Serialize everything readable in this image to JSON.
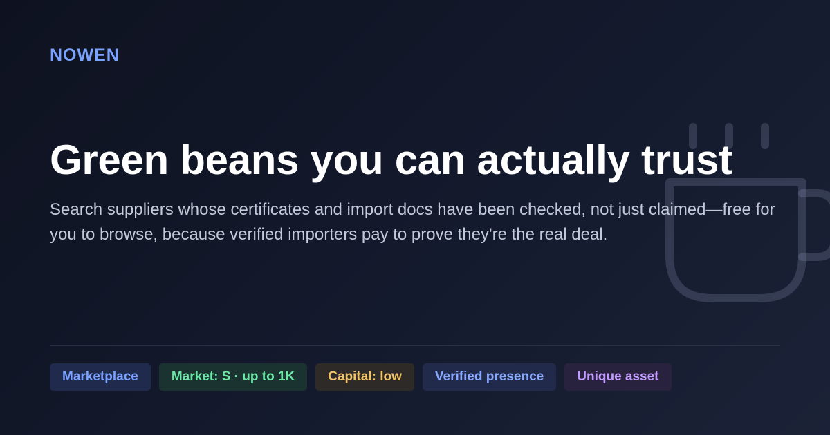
{
  "brand": {
    "name": "NOWEN"
  },
  "hero": {
    "headline": "Green beans you can actually trust",
    "subtext": "Search suppliers whose certificates and import docs have been checked, not just claimed—free for you to browse, because verified importers pay to prove they're the real deal."
  },
  "tags": [
    {
      "label": "Marketplace",
      "color": "#7aa2ff"
    },
    {
      "label": "Market: S · up to 1K",
      "color": "#6ee7a6"
    },
    {
      "label": "Capital: low",
      "color": "#f0c26a"
    },
    {
      "label": "Verified presence",
      "color": "#89a9ff"
    },
    {
      "label": "Unique asset",
      "color": "#c39cff"
    }
  ],
  "decoration": {
    "icon": "coffee-mug-icon",
    "color": "#9aa6c4"
  },
  "colors": {
    "background": "#111627",
    "accent": "#7aa2ff",
    "headline": "#ffffff",
    "body_text": "#c2c9d8"
  }
}
